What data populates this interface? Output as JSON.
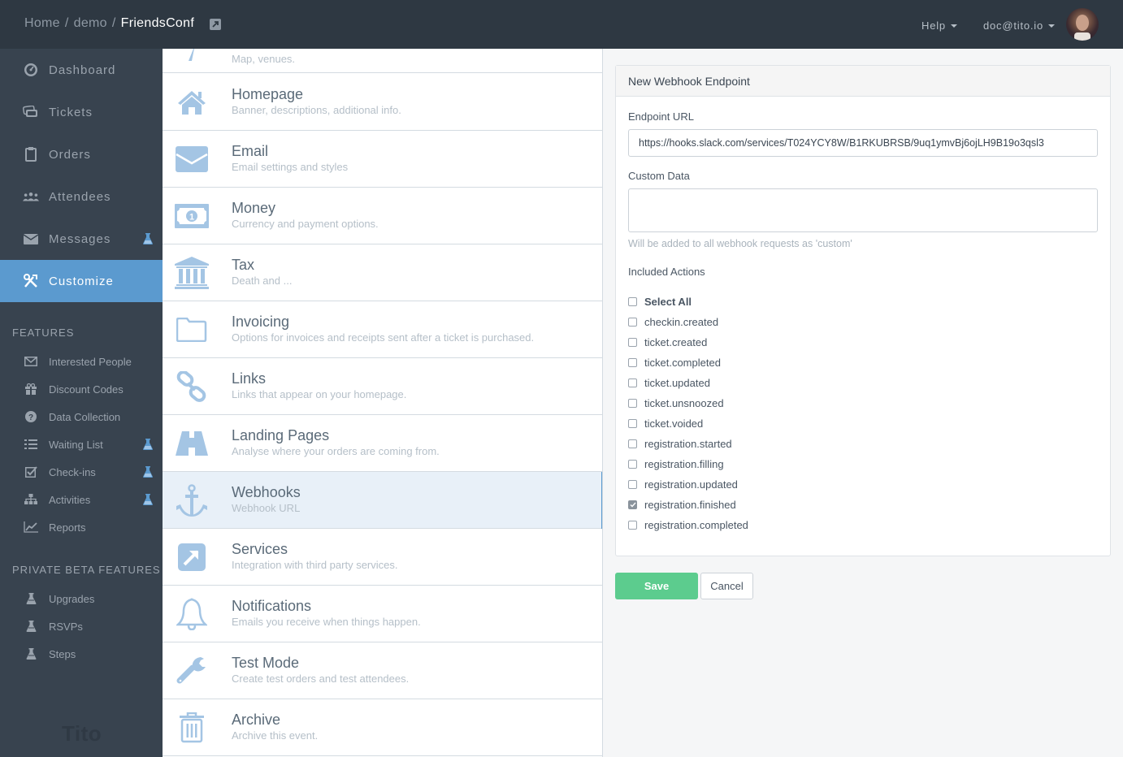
{
  "header": {
    "breadcrumb": [
      "Home",
      "demo",
      "FriendsConf"
    ],
    "separator": "/",
    "help_label": "Help",
    "user_label": "doc@tito.io"
  },
  "sidebar": {
    "main": [
      {
        "label": "Dashboard",
        "icon": "dashboard-icon"
      },
      {
        "label": "Tickets",
        "icon": "tickets-icon"
      },
      {
        "label": "Orders",
        "icon": "clipboard-icon"
      },
      {
        "label": "Attendees",
        "icon": "users-icon"
      },
      {
        "label": "Messages",
        "icon": "envelope-icon",
        "beta": true
      },
      {
        "label": "Customize",
        "icon": "tools-icon",
        "active": true
      }
    ],
    "features_title": "FEATURES",
    "features": [
      {
        "label": "Interested People",
        "icon": "envelope-outline-icon"
      },
      {
        "label": "Discount Codes",
        "icon": "gift-icon"
      },
      {
        "label": "Data Collection",
        "icon": "question-icon"
      },
      {
        "label": "Waiting List",
        "icon": "list-icon",
        "beta": true
      },
      {
        "label": "Check-ins",
        "icon": "checkbox-icon",
        "beta": true
      },
      {
        "label": "Activities",
        "icon": "sitemap-icon",
        "beta": true
      },
      {
        "label": "Reports",
        "icon": "line-chart-icon"
      }
    ],
    "private_title": "PRIVATE BETA FEATURES",
    "private": [
      {
        "label": "Upgrades"
      },
      {
        "label": "RSVPs"
      },
      {
        "label": "Steps"
      }
    ],
    "logo": "Tito"
  },
  "settings": [
    {
      "title": "",
      "desc": "Map, venues."
    },
    {
      "title": "Homepage",
      "desc": "Banner, descriptions, additional info."
    },
    {
      "title": "Email",
      "desc": "Email settings and styles"
    },
    {
      "title": "Money",
      "desc": "Currency and payment options."
    },
    {
      "title": "Tax",
      "desc": "Death and ..."
    },
    {
      "title": "Invoicing",
      "desc": "Options for invoices and receipts sent after a ticket is purchased."
    },
    {
      "title": "Links",
      "desc": "Links that appear on your homepage."
    },
    {
      "title": "Landing Pages",
      "desc": "Analyse where your orders are coming from."
    },
    {
      "title": "Webhooks",
      "desc": "Webhook URL"
    },
    {
      "title": "Services",
      "desc": "Integration with third party services."
    },
    {
      "title": "Notifications",
      "desc": "Emails you receive when things happen."
    },
    {
      "title": "Test Mode",
      "desc": "Create test orders and test attendees."
    },
    {
      "title": "Archive",
      "desc": "Archive this event."
    }
  ],
  "form": {
    "title": "New Webhook Endpoint",
    "endpoint_label": "Endpoint URL",
    "endpoint_value": "https://hooks.slack.com/services/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",
    "custom_label": "Custom Data",
    "custom_value": "",
    "custom_help": "Will be added to all webhook requests as 'custom'",
    "actions_label": "Included Actions",
    "select_all_label": "Select All",
    "actions": [
      {
        "label": "checkin.created",
        "checked": false
      },
      {
        "label": "ticket.created",
        "checked": false
      },
      {
        "label": "ticket.completed",
        "checked": false
      },
      {
        "label": "ticket.updated",
        "checked": false
      },
      {
        "label": "ticket.unsnoozed",
        "checked": false
      },
      {
        "label": "ticket.voided",
        "checked": false
      },
      {
        "label": "registration.started",
        "checked": false
      },
      {
        "label": "registration.filling",
        "checked": false
      },
      {
        "label": "registration.updated",
        "checked": false
      },
      {
        "label": "registration.finished",
        "checked": true
      },
      {
        "label": "registration.completed",
        "checked": false
      }
    ],
    "save_label": "Save",
    "cancel_label": "Cancel"
  },
  "colors": {
    "accent": "#5b9acf",
    "save": "#5ccc8e",
    "topbar": "#2e3842",
    "sidebar": "#38434f",
    "beta_flask": "#5b9acf"
  }
}
